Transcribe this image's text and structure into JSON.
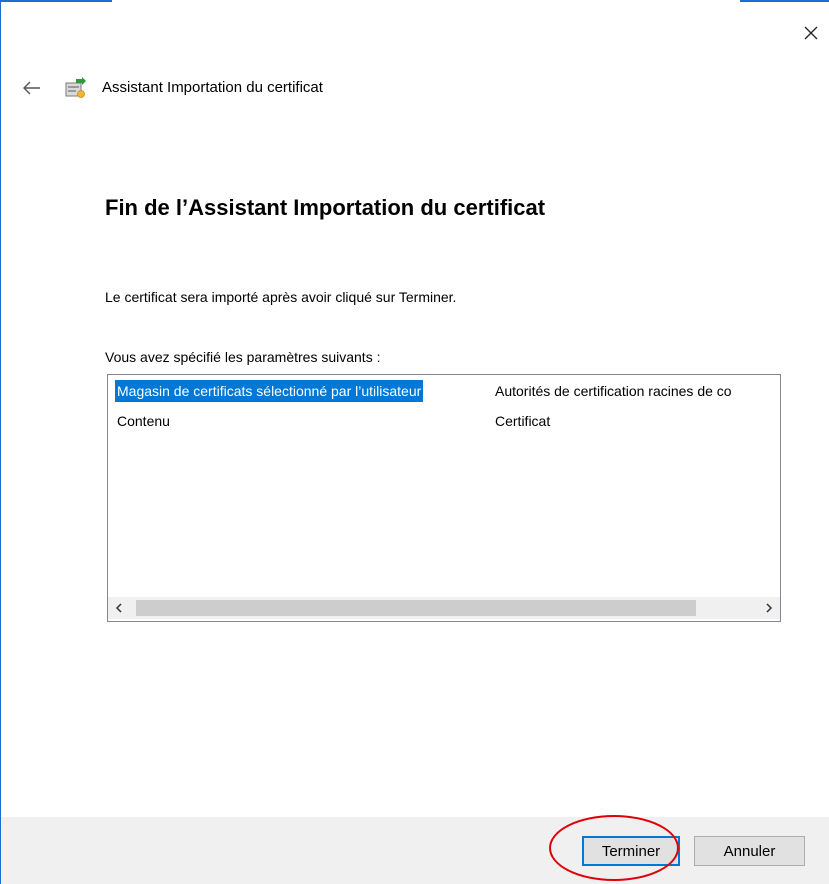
{
  "window": {
    "title": "Assistant Importation du certificat",
    "close_glyph": "✕",
    "back_glyph": "←",
    "icons": {
      "close": "close-icon",
      "back": "back-arrow-icon",
      "wizard": "certificate-wizard-icon"
    }
  },
  "page": {
    "heading": "Fin de l’Assistant Importation du certificat",
    "info_text": "Le certificat sera importé après avoir cliqué sur Terminer.",
    "params_label": "Vous avez spécifié les paramètres suivants :"
  },
  "settings_list": {
    "rows": [
      {
        "key": "Magasin de certificats sélectionné par l’utilisateur",
        "value": "Autorités de certification racines de co",
        "selected": true
      },
      {
        "key": "Contenu",
        "value": "Certificat",
        "selected": false
      }
    ],
    "scroll_left_glyph": "‹",
    "scroll_right_glyph": "›"
  },
  "buttons": {
    "finish": "Terminer",
    "cancel": "Annuler"
  },
  "colors": {
    "accent": "#0078d7",
    "annotation": "#e0000a",
    "footer_bg": "#f0f0f0"
  }
}
